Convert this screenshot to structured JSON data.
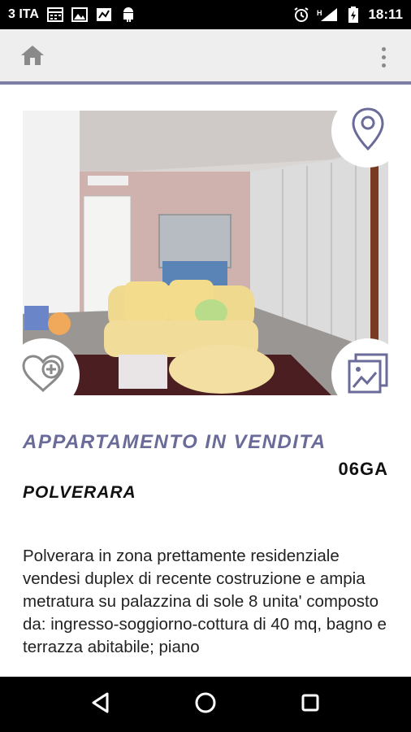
{
  "status_bar": {
    "carrier": "3 ITA",
    "time": "18:11",
    "signal_label": "H",
    "icons_left": [
      "calendar-icon",
      "image-icon",
      "chart-icon",
      "android-icon"
    ],
    "icons_right": [
      "alarm-icon",
      "signal-icon",
      "battery-icon"
    ]
  },
  "app_bar": {
    "home_icon": "home-icon",
    "menu_icon": "overflow-menu-icon",
    "accent_color": "#7d7ea5"
  },
  "listing": {
    "photo_alt": "living-room-photo",
    "map_icon": "map-pin-icon",
    "favorite_icon": "heart-plus-icon",
    "gallery_icon": "gallery-icon",
    "title": "APPARTAMENTO IN VENDITA",
    "code": "06GA",
    "city": "POLVERARA",
    "description": "Polverara in zona prettamente residenziale vendesi duplex di recente costruzione e ampia metratura su palazzina di sole 8 unita' composto da: ingresso-soggiorno-cottura di 40 mq, bagno e terrazza abitabile; piano",
    "title_color": "#6a6b99"
  },
  "nav_bar": {
    "back_icon": "back-triangle-icon",
    "home_icon": "home-circle-icon",
    "recents_icon": "recents-square-icon"
  }
}
